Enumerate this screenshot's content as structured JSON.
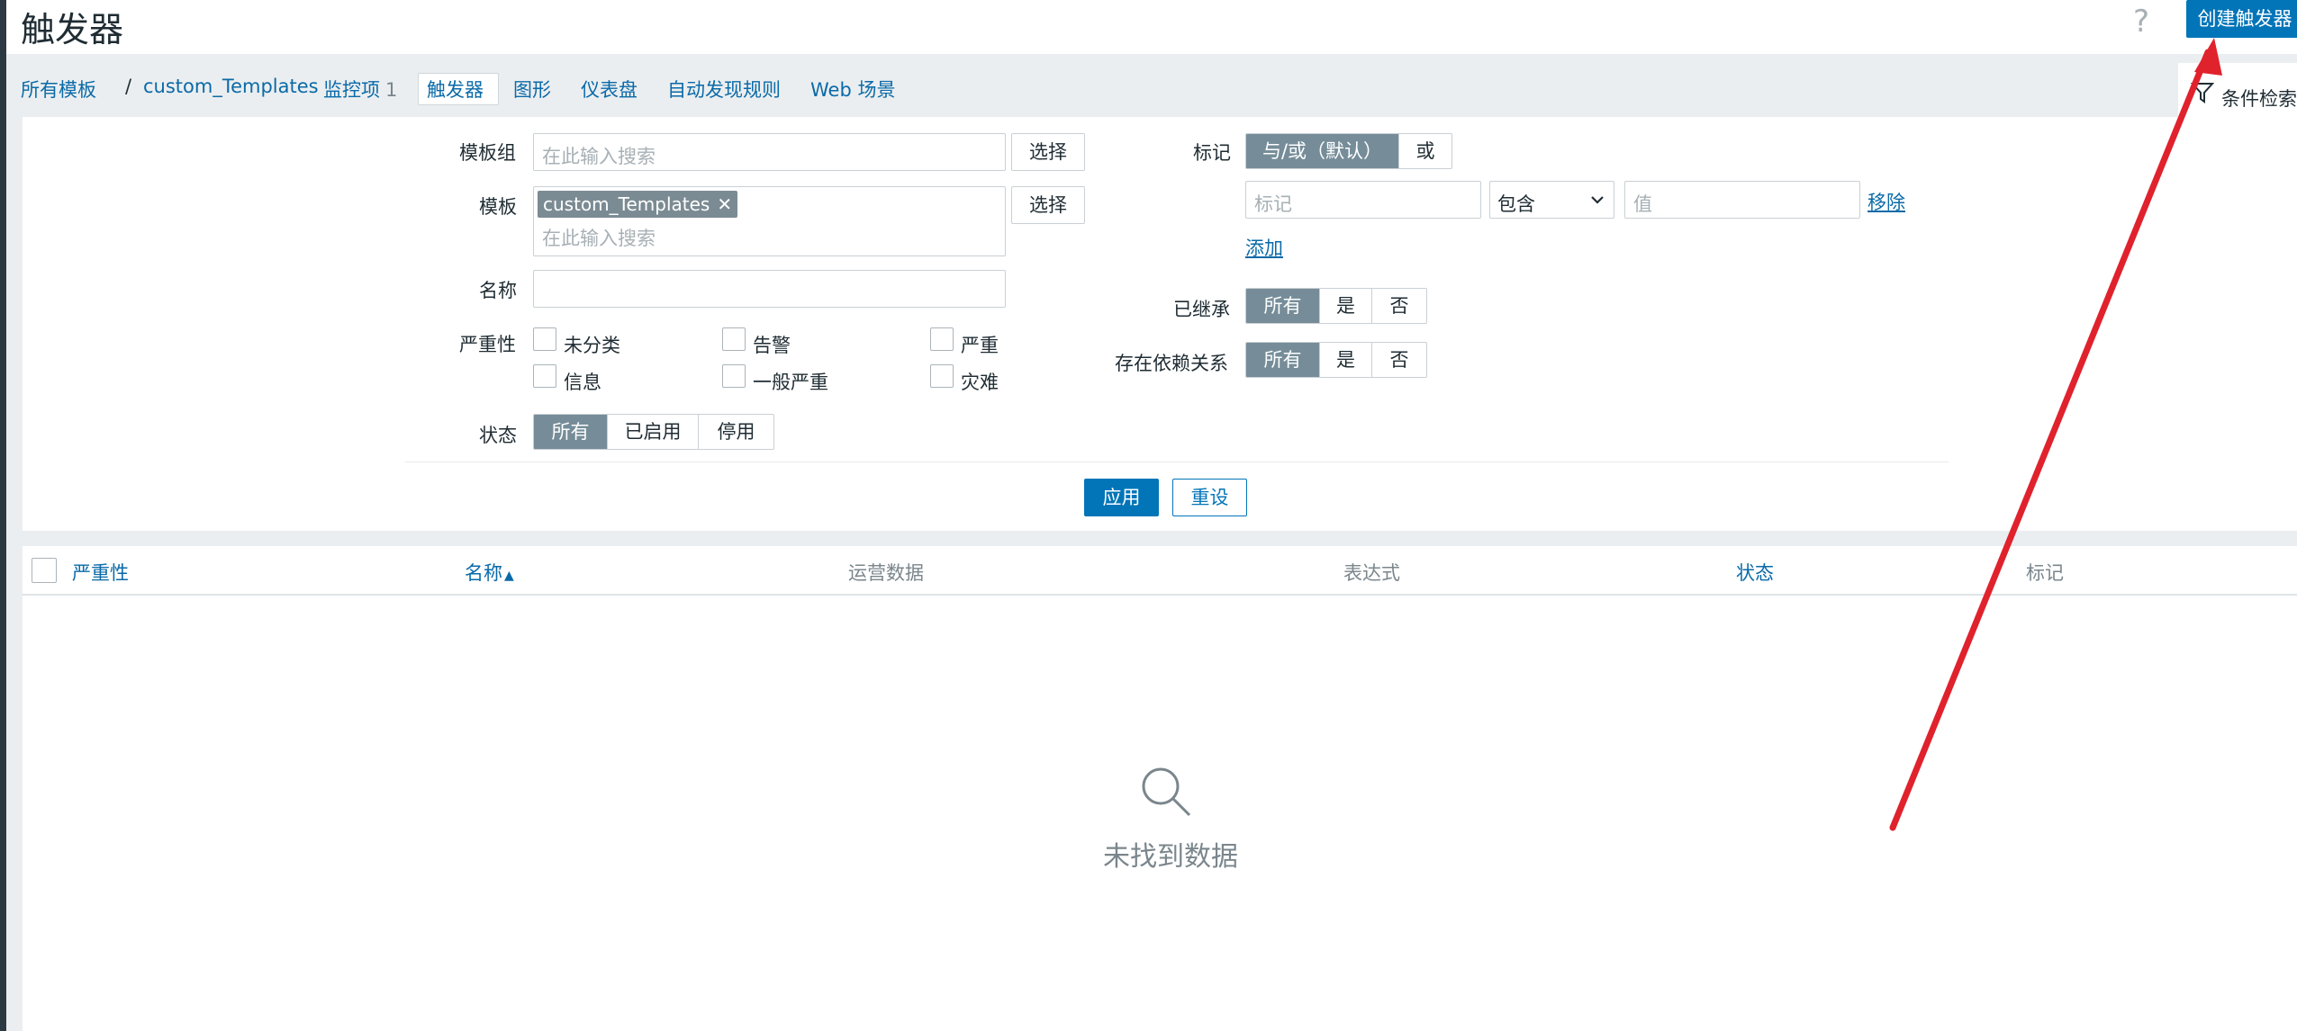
{
  "header": {
    "title": "触发器",
    "help_glyph": "?",
    "create_button": "创建触发器"
  },
  "nav": {
    "all_templates": "所有模板",
    "separator": "/",
    "template_name": "custom_Templates",
    "items_label": "监控项",
    "items_count": "1",
    "triggers": "触发器",
    "graphs": "图形",
    "dashboards": "仪表盘",
    "discovery": "自动发现规则",
    "web": "Web 场景",
    "filter_tab": "条件检索"
  },
  "filter": {
    "template_group_label": "模板组",
    "template_group_placeholder": "在此输入搜索",
    "template_label": "模板",
    "template_chip": "custom_Templates",
    "template_chip_remove": "✕",
    "template_placeholder": "在此输入搜索",
    "select_button": "选择",
    "name_label": "名称",
    "name_value": "",
    "severity_label": "严重性",
    "severities": [
      "未分类",
      "告警",
      "严重",
      "信息",
      "一般严重",
      "灾难"
    ],
    "status_label": "状态",
    "status_options": [
      "所有",
      "已启用",
      "停用"
    ],
    "status_selected": "所有",
    "tags_label": "标记",
    "tags_mode_options": [
      "与/或（默认）",
      "或"
    ],
    "tags_mode_selected": "与/或（默认）",
    "tag_placeholder": "标记",
    "tag_operator": "包含",
    "tag_value_placeholder": "值",
    "remove_link": "移除",
    "add_link": "添加",
    "inherited_label": "已继承",
    "inherited_options": [
      "所有",
      "是",
      "否"
    ],
    "inherited_selected": "所有",
    "dependencies_label": "存在依赖关系",
    "dependencies_options": [
      "所有",
      "是",
      "否"
    ],
    "dependencies_selected": "所有",
    "apply_button": "应用",
    "reset_button": "重设"
  },
  "table": {
    "columns": [
      "严重性",
      "名称",
      "运营数据",
      "表达式",
      "状态",
      "标记"
    ],
    "sort_indicator": "▲",
    "empty_text": "未找到数据"
  },
  "colors": {
    "primary": "#0275b8",
    "link": "#0a6aa8",
    "segment_selected": "#768d99",
    "annotation_arrow": "#e0222d"
  }
}
